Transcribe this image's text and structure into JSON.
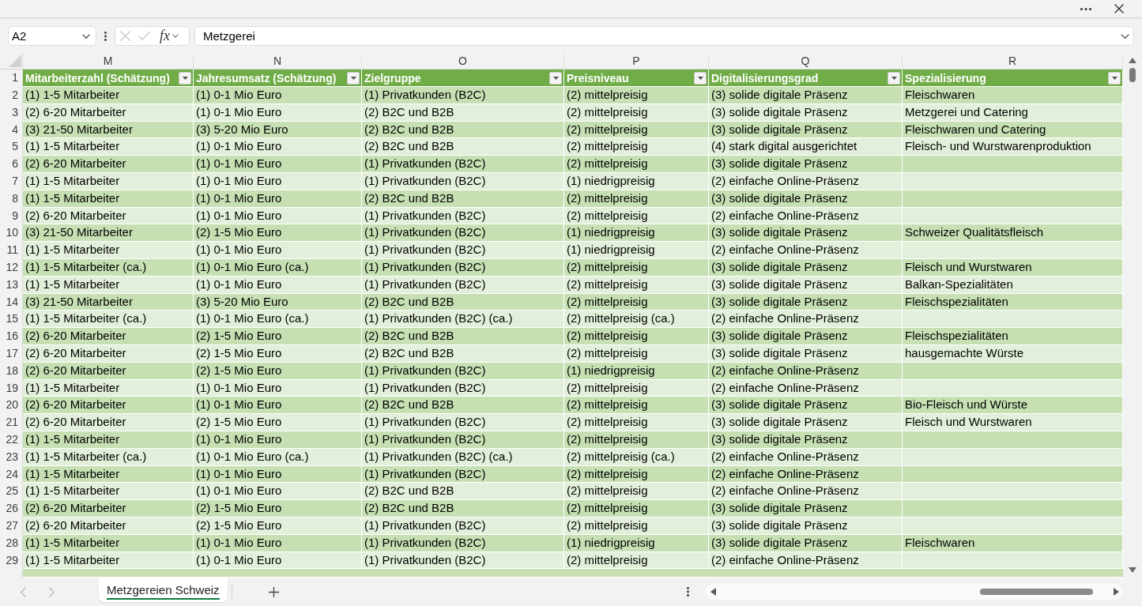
{
  "formula_bar": {
    "name_box": "A2",
    "confirm_buttons_disabled": true,
    "function_label": "fx",
    "formula": "Metzgerei"
  },
  "sheet": {
    "columns": [
      {
        "letter": "M",
        "heading": "Mitarbeiterzahl (Schätzung)"
      },
      {
        "letter": "N",
        "heading": "Jahresumsatz (Schätzung)"
      },
      {
        "letter": "O",
        "heading": "Zielgruppe"
      },
      {
        "letter": "P",
        "heading": "Preisniveau"
      },
      {
        "letter": "Q",
        "heading": "Digitalisierungsgrad"
      },
      {
        "letter": "R",
        "heading": "Spezialisierung"
      }
    ],
    "header_row_number": "1",
    "rows": [
      {
        "number": "2",
        "cells": [
          "(1) 1-5 Mitarbeiter",
          "(1) 0-1 Mio Euro",
          "(1) Privatkunden (B2C)",
          "(2) mittelpreisig",
          "(3) solide digitale Präsenz",
          "Fleischwaren"
        ]
      },
      {
        "number": "3",
        "cells": [
          "(2) 6-20 Mitarbeiter",
          "(1) 0-1 Mio Euro",
          "(2) B2C und B2B",
          "(2) mittelpreisig",
          "(3) solide digitale Präsenz",
          "Metzgerei und Catering"
        ]
      },
      {
        "number": "4",
        "cells": [
          "(3) 21-50 Mitarbeiter",
          "(3) 5-20 Mio Euro",
          "(2) B2C und B2B",
          "(2) mittelpreisig",
          "(3) solide digitale Präsenz",
          "Fleischwaren und Catering"
        ]
      },
      {
        "number": "5",
        "cells": [
          "(1) 1-5 Mitarbeiter",
          "(1) 0-1 Mio Euro",
          "(2) B2C und B2B",
          "(2) mittelpreisig",
          "(4) stark digital ausgerichtet",
          "Fleisch- und Wurstwarenproduktion"
        ]
      },
      {
        "number": "6",
        "cells": [
          "(2) 6-20 Mitarbeiter",
          "(1) 0-1 Mio Euro",
          "(1) Privatkunden (B2C)",
          "(2) mittelpreisig",
          "(3) solide digitale Präsenz"
        ]
      },
      {
        "number": "7",
        "cells": [
          "(1) 1-5 Mitarbeiter",
          "(1) 0-1 Mio Euro",
          "(1) Privatkunden (B2C)",
          "(1) niedrigpreisig",
          "(2) einfache Online-Präsenz"
        ]
      },
      {
        "number": "8",
        "cells": [
          "(1) 1-5 Mitarbeiter",
          "(1) 0-1 Mio Euro",
          "(2) B2C und B2B",
          "(2) mittelpreisig",
          "(3) solide digitale Präsenz"
        ]
      },
      {
        "number": "9",
        "cells": [
          "(2) 6-20 Mitarbeiter",
          "(1) 0-1 Mio Euro",
          "(1) Privatkunden (B2C)",
          "(2) mittelpreisig",
          "(2) einfache Online-Präsenz"
        ]
      },
      {
        "number": "10",
        "cells": [
          "(3) 21-50 Mitarbeiter",
          "(2) 1-5 Mio Euro",
          "(1) Privatkunden (B2C)",
          "(1) niedrigpreisig",
          "(3) solide digitale Präsenz",
          "Schweizer Qualitätsfleisch"
        ]
      },
      {
        "number": "11",
        "cells": [
          "(1) 1-5 Mitarbeiter",
          "(1) 0-1 Mio Euro",
          "(1) Privatkunden (B2C)",
          "(1) niedrigpreisig",
          "(2) einfache Online-Präsenz"
        ]
      },
      {
        "number": "12",
        "cells": [
          "(1) 1-5 Mitarbeiter (ca.)",
          "(1) 0-1 Mio Euro (ca.)",
          "(1) Privatkunden (B2C)",
          "(2) mittelpreisig",
          "(3) solide digitale Präsenz",
          "Fleisch und Wurstwaren"
        ]
      },
      {
        "number": "13",
        "cells": [
          "(1) 1-5 Mitarbeiter",
          "(1) 0-1 Mio Euro",
          "(1) Privatkunden (B2C)",
          "(2) mittelpreisig",
          "(3) solide digitale Präsenz",
          "Balkan-Spezialitäten"
        ]
      },
      {
        "number": "14",
        "cells": [
          "(3) 21-50 Mitarbeiter",
          "(3) 5-20 Mio Euro",
          "(2) B2C und B2B",
          "(2) mittelpreisig",
          "(3) solide digitale Präsenz",
          "Fleischspezialitäten"
        ]
      },
      {
        "number": "15",
        "cells": [
          "(1) 1-5 Mitarbeiter (ca.)",
          "(1) 0-1 Mio Euro (ca.)",
          "(1) Privatkunden (B2C) (ca.)",
          "(2) mittelpreisig (ca.)",
          "(2) einfache Online-Präsenz"
        ]
      },
      {
        "number": "16",
        "cells": [
          "(2) 6-20 Mitarbeiter",
          "(2) 1-5 Mio Euro",
          "(2) B2C und B2B",
          "(2) mittelpreisig",
          "(3) solide digitale Präsenz",
          "Fleischspezialitäten"
        ]
      },
      {
        "number": "17",
        "cells": [
          "(2) 6-20 Mitarbeiter",
          "(2) 1-5 Mio Euro",
          "(2) B2C und B2B",
          "(2) mittelpreisig",
          "(3) solide digitale Präsenz",
          "hausgemachte Würste"
        ]
      },
      {
        "number": "18",
        "cells": [
          "(2) 6-20 Mitarbeiter",
          "(2) 1-5 Mio Euro",
          "(1) Privatkunden (B2C)",
          "(1) niedrigpreisig",
          "(2) einfache Online-Präsenz"
        ]
      },
      {
        "number": "19",
        "cells": [
          "(1) 1-5 Mitarbeiter",
          "(1) 0-1 Mio Euro",
          "(1) Privatkunden (B2C)",
          "(2) mittelpreisig",
          "(2) einfache Online-Präsenz"
        ]
      },
      {
        "number": "20",
        "cells": [
          "(2) 6-20 Mitarbeiter",
          "(1) 0-1 Mio Euro",
          "(2) B2C und B2B",
          "(2) mittelpreisig",
          "(3) solide digitale Präsenz",
          "Bio-Fleisch und Würste"
        ]
      },
      {
        "number": "21",
        "cells": [
          "(2) 6-20 Mitarbeiter",
          "(2) 1-5 Mio Euro",
          "(1) Privatkunden (B2C)",
          "(2) mittelpreisig",
          "(3) solide digitale Präsenz",
          "Fleisch und Wurstwaren"
        ]
      },
      {
        "number": "22",
        "cells": [
          "(1) 1-5 Mitarbeiter",
          "(1) 0-1 Mio Euro",
          "(1) Privatkunden (B2C)",
          "(2) mittelpreisig",
          "(3) solide digitale Präsenz"
        ]
      },
      {
        "number": "23",
        "cells": [
          "(1) 1-5 Mitarbeiter (ca.)",
          "(1) 0-1 Mio Euro (ca.)",
          "(1) Privatkunden (B2C) (ca.)",
          "(2) mittelpreisig (ca.)",
          "(2) einfache Online-Präsenz"
        ]
      },
      {
        "number": "24",
        "cells": [
          "(1) 1-5 Mitarbeiter",
          "(1) 0-1 Mio Euro",
          "(1) Privatkunden (B2C)",
          "(2) mittelpreisig",
          "(2) einfache Online-Präsenz"
        ]
      },
      {
        "number": "25",
        "cells": [
          "(1) 1-5 Mitarbeiter",
          "(1) 0-1 Mio Euro",
          "(2) B2C und B2B",
          "(2) mittelpreisig",
          "(2) einfache Online-Präsenz"
        ]
      },
      {
        "number": "26",
        "cells": [
          "(2) 6-20 Mitarbeiter",
          "(2) 1-5 Mio Euro",
          "(2) B2C und B2B",
          "(2) mittelpreisig",
          "(3) solide digitale Präsenz"
        ]
      },
      {
        "number": "27",
        "cells": [
          "(2) 6-20 Mitarbeiter",
          "(2) 1-5 Mio Euro",
          "(1) Privatkunden (B2C)",
          "(2) mittelpreisig",
          "(3) solide digitale Präsenz"
        ]
      },
      {
        "number": "28",
        "cells": [
          "(1) 1-5 Mitarbeiter",
          "(1) 0-1 Mio Euro",
          "(1) Privatkunden (B2C)",
          "(1) niedrigpreisig",
          "(3) solide digitale Präsenz",
          "Fleischwaren"
        ]
      },
      {
        "number": "29",
        "cells": [
          "(1) 1-5 Mitarbeiter",
          "(1) 0-1 Mio Euro",
          "(1) Privatkunden (B2C)",
          "(2) mittelpreisig",
          "(2) einfache Online-Präsenz"
        ]
      }
    ]
  },
  "sheet_bar": {
    "navigation_disabled": true,
    "tabs": [
      {
        "label": "Metzgereien Schweiz",
        "selected": true
      }
    ]
  }
}
